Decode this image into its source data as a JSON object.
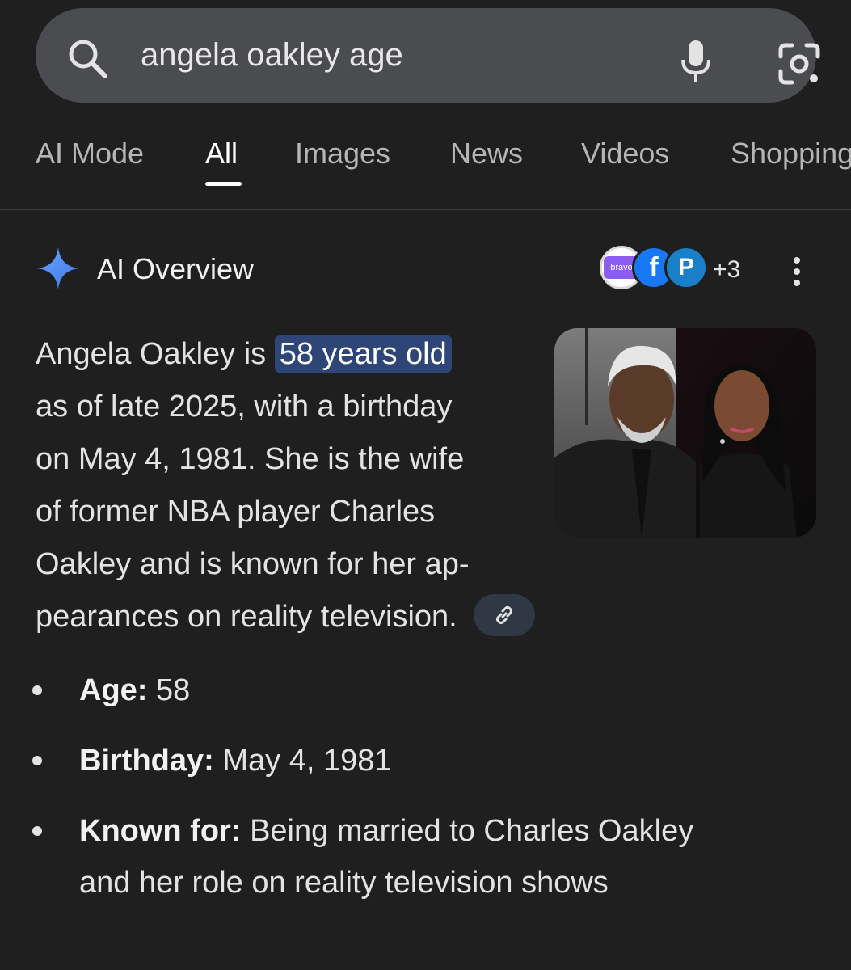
{
  "search": {
    "query": "angela oakley age"
  },
  "tabs": [
    {
      "label": "AI Mode",
      "active": false
    },
    {
      "label": "All",
      "active": true
    },
    {
      "label": "Images",
      "active": false
    },
    {
      "label": "News",
      "active": false
    },
    {
      "label": "Videos",
      "active": false
    },
    {
      "label": "Shopping",
      "active": false
    }
  ],
  "ai_overview": {
    "title": "AI Overview",
    "sources": {
      "bravo_label": "bravo",
      "fb_label": "f",
      "p_label": "P",
      "more_count": "+3"
    },
    "summary": {
      "prefix": "Angela Oakley is ",
      "highlight": "58 years old",
      "lines": [
        "as of late 2025, with a birthday",
        "on May 4, 1981. She is the wife",
        "of former NBA player Charles",
        "Oakley and is known for her ap-",
        "pearances on reality television."
      ]
    },
    "facts": [
      {
        "label": "Age:",
        "value": " 58",
        "value_lines": [
          " 58"
        ]
      },
      {
        "label": "Birthday:",
        "value": " May 4, 1981",
        "value_lines": [
          " May 4, 1981"
        ]
      },
      {
        "label": "Known for:",
        "value": " Being married to Charles Oakley and her role on reality television shows",
        "value_lines": [
          " Being married to Charles Oakley",
          "and her role on reality television shows"
        ]
      }
    ]
  },
  "colors": {
    "background": "#1f1f1f",
    "search_bar": "#4a4c4f",
    "highlight": "#2e4577",
    "sparkle_blue": "#4b8bf5"
  }
}
